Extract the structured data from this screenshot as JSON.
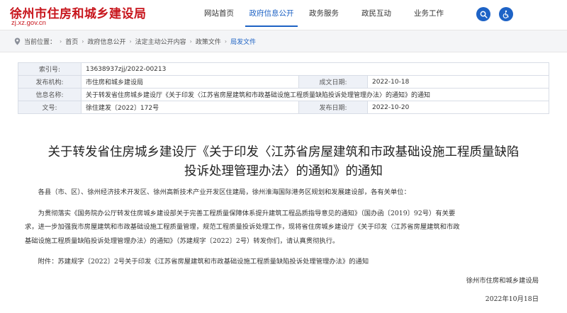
{
  "header": {
    "site_title": "徐州市住房和城乡建设局",
    "site_domain": "zj.xz.gov.cn",
    "nav": [
      "网站首页",
      "政府信息公开",
      "政务服务",
      "政民互动",
      "业务工作"
    ],
    "active_nav_index": 1,
    "icons": [
      "search-icon",
      "accessibility-icon"
    ],
    "accent_color": "#c8161d",
    "nav_color": "#1d62c4"
  },
  "breadcrumb": {
    "prefix": "当前位置：",
    "items": [
      "首页",
      "政府信息公开",
      "法定主动公开内容",
      "政策文件",
      "局发文件"
    ]
  },
  "meta": {
    "index_label": "索引号:",
    "index_value": "13638937zjj/2022-00213",
    "publisher_label": "发布机构:",
    "publisher_value": "市住房和城乡建设局",
    "created_label": "成文日期:",
    "created_value": "2022-10-18",
    "info_name_label": "信息名称:",
    "info_name_value": "关于转发省住房城乡建设厅《关于印发〈江苏省房屋建筑和市政基础设施工程质量缺陷投诉处理管理办法〉的通知》的通知",
    "doc_no_label": "文号:",
    "doc_no_value": "徐住建发〔2022〕172号",
    "published_label": "发布日期:",
    "published_value": "2022-10-20"
  },
  "document": {
    "title_line1": "关于转发省住房城乡建设厅《关于印发〈江苏省房屋建筑和市政基础设施工程质量缺陷",
    "title_line2": "投诉处理管理办法〉的通知》的通知",
    "salutation": "各县（市、区）、徐州经济技术开发区、徐州高新技术产业开发区住建局，徐州淮海国际港务区规划和发展建设部，各有关单位：",
    "para1_line1": "为贯彻落实《国务院办公厅转发住房城乡建设部关于完善工程质量保障体系提升建筑工程品质指导意见的通知》（国办函〔2019〕92号）有关要",
    "para1_line2": "求，进一步加强我市房屋建筑和市政基础设施工程质量管理，规范工程质量投诉处理工作，现将省住房城乡建设厅《关于印发〈江苏省房屋建筑和市政",
    "para1_line3": "基础设施工程质量缺陷投诉处理管理办法〉的通知》（苏建规字〔2022〕2号）转发你们，请认真贯彻执行。",
    "attachment": "附件：苏建规字〔2022〕2号关于印发《江苏省房屋建筑和市政基础设施工程质量缺陷投诉处理管理办法》的通知",
    "signature": "徐州市住房和城乡建设局",
    "date": "2022年10月18日"
  }
}
